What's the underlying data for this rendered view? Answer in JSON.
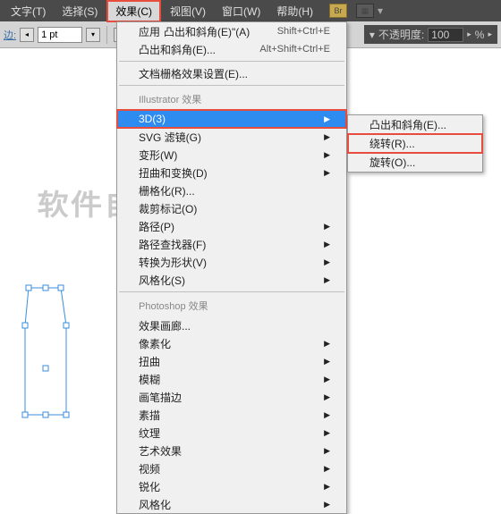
{
  "menubar": {
    "items": [
      "文字(T)",
      "选择(S)",
      "效果(C)",
      "视图(V)",
      "窗口(W)",
      "帮助(H)"
    ],
    "highlighted_index": 2,
    "br_label": "Br"
  },
  "toolbar": {
    "stroke_label": "边:",
    "stroke_value": "1 pt",
    "opacity_label": "不透明度:",
    "opacity_value": "100",
    "percent": "%"
  },
  "dropdown": {
    "items_top": [
      {
        "label": "应用",
        "shortcut": "Shift+Ctrl+E"
      },
      {
        "label": "凸出和斜角(E)\"(A)",
        "shortcut": ""
      },
      {
        "label": "凸出和斜角(E)...",
        "shortcut": "Alt+Shift+Ctrl+E"
      }
    ],
    "items_doc": [
      {
        "label": "文档栅格效果设置(E)...",
        "shortcut": ""
      }
    ],
    "header_ai": "Illustrator 效果",
    "items_ai": [
      {
        "label": "3D(3)",
        "has_sub": true,
        "selected": true
      },
      {
        "label": "SVG 滤镜(G)",
        "has_sub": true
      },
      {
        "label": "变形(W)",
        "has_sub": true
      },
      {
        "label": "扭曲和变换(D)",
        "has_sub": true
      },
      {
        "label": "栅格化(R)...",
        "has_sub": false
      },
      {
        "label": "裁剪标记(O)",
        "has_sub": false
      },
      {
        "label": "路径(P)",
        "has_sub": true
      },
      {
        "label": "路径查找器(F)",
        "has_sub": true
      },
      {
        "label": "转换为形状(V)",
        "has_sub": true
      },
      {
        "label": "风格化(S)",
        "has_sub": true
      }
    ],
    "header_ps": "Photoshop 效果",
    "items_ps": [
      {
        "label": "效果画廊...",
        "has_sub": false
      },
      {
        "label": "像素化",
        "has_sub": true
      },
      {
        "label": "扭曲",
        "has_sub": true
      },
      {
        "label": "模糊",
        "has_sub": true
      },
      {
        "label": "画笔描边",
        "has_sub": true
      },
      {
        "label": "素描",
        "has_sub": true
      },
      {
        "label": "纹理",
        "has_sub": true
      },
      {
        "label": "艺术效果",
        "has_sub": true
      },
      {
        "label": "视频",
        "has_sub": true
      },
      {
        "label": "锐化",
        "has_sub": true
      },
      {
        "label": "风格化",
        "has_sub": true
      }
    ]
  },
  "submenu": {
    "items": [
      {
        "label": "凸出和斜角(E)...",
        "highlighted": false
      },
      {
        "label": "绕转(R)...",
        "highlighted": true
      },
      {
        "label": "旋转(O)...",
        "highlighted": false
      }
    ]
  },
  "watermark": "软件自学网"
}
